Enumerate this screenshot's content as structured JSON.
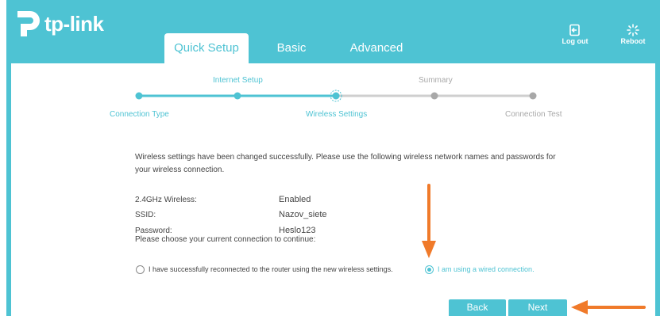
{
  "brand": {
    "name": "tp-link"
  },
  "tabs": [
    {
      "label": "Quick Setup",
      "active": true
    },
    {
      "label": "Basic",
      "active": false
    },
    {
      "label": "Advanced",
      "active": false
    }
  ],
  "header_actions": {
    "logout_label": "Log out",
    "reboot_label": "Reboot"
  },
  "progress": {
    "steps": [
      {
        "label": "Connection Type",
        "state": "done"
      },
      {
        "label": "Internet Setup",
        "state": "done"
      },
      {
        "label": "Wireless Settings",
        "state": "current"
      },
      {
        "label": "Summary",
        "state": "pending"
      },
      {
        "label": "Connection Test",
        "state": "pending"
      }
    ]
  },
  "message": "Wireless settings have been changed successfully. Please use the following wireless network names and passwords for your wireless connection.",
  "settings": {
    "wireless_label": "2.4GHz Wireless:",
    "wireless_value": "Enabled",
    "ssid_label": "SSID:",
    "ssid_value": "Nazov_siete",
    "password_label": "Password:",
    "password_value": "Heslo123"
  },
  "choose_prompt": "Please choose your current connection to continue:",
  "options": {
    "reconnected": {
      "label": "I have successfully reconnected to the router using the new wireless settings.",
      "selected": false
    },
    "wired": {
      "label": "I am using a wired connection.",
      "selected": true
    }
  },
  "buttons": {
    "back": "Back",
    "next": "Next"
  },
  "colors": {
    "accent": "#4ec3d3",
    "annotation_arrow": "#f07a2a",
    "pending": "#a8a8a8"
  }
}
